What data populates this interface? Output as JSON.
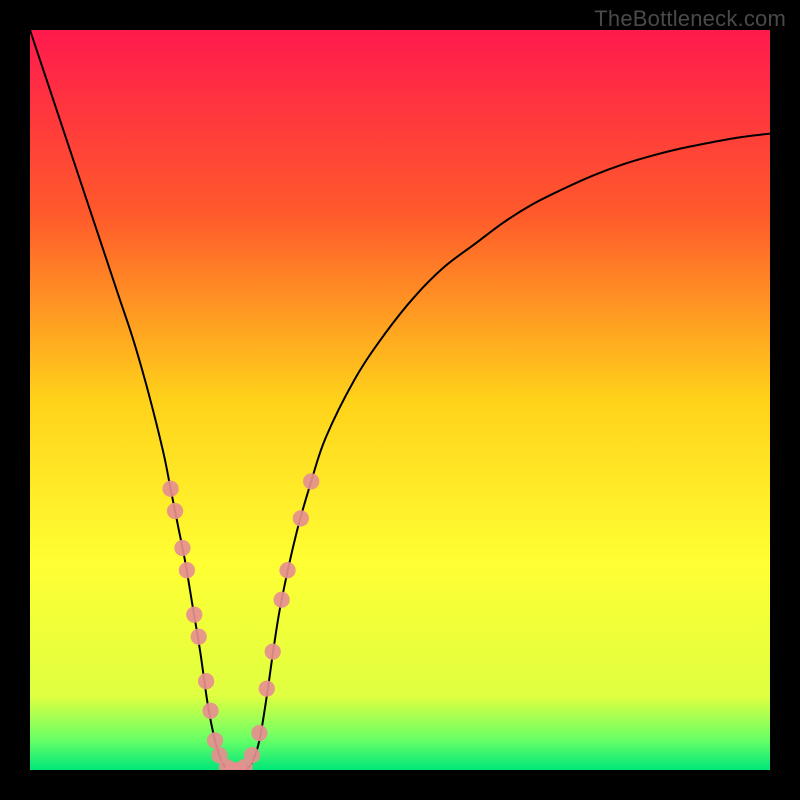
{
  "watermark": "TheBottleneck.com",
  "chart_data": {
    "type": "line",
    "title": "",
    "xlabel": "",
    "ylabel": "",
    "xlim": [
      0,
      100
    ],
    "ylim": [
      0,
      100
    ],
    "grid": false,
    "background_gradient": {
      "stops": [
        {
          "pos": 0.0,
          "color": "#ff1a4d"
        },
        {
          "pos": 0.25,
          "color": "#ff5a2b"
        },
        {
          "pos": 0.5,
          "color": "#ffd21a"
        },
        {
          "pos": 0.72,
          "color": "#ffff33"
        },
        {
          "pos": 0.9,
          "color": "#dfff40"
        },
        {
          "pos": 0.96,
          "color": "#66ff66"
        },
        {
          "pos": 1.0,
          "color": "#00e67a"
        }
      ]
    },
    "series": [
      {
        "name": "bottleneck-curve",
        "color": "#000000",
        "x": [
          0,
          2,
          4,
          6,
          8,
          10,
          12,
          14,
          16,
          18,
          19,
          20,
          21,
          22,
          23,
          24,
          25,
          26,
          27,
          28,
          29,
          30,
          31,
          32,
          33,
          34,
          36,
          38,
          40,
          44,
          48,
          52,
          56,
          60,
          64,
          68,
          72,
          76,
          80,
          84,
          88,
          92,
          96,
          100
        ],
        "y": [
          100,
          94,
          88,
          82,
          76,
          70,
          64,
          58,
          51,
          43,
          38,
          33,
          28,
          22,
          16,
          9,
          4,
          1,
          0,
          0,
          0,
          1,
          4,
          10,
          17,
          23,
          32,
          39,
          45,
          53,
          59,
          64,
          68,
          71,
          74,
          76.5,
          78.5,
          80.3,
          81.8,
          83,
          84,
          84.8,
          85.5,
          86
        ]
      }
    ],
    "highlight_points": {
      "name": "data-markers",
      "color": "#e68f8f",
      "radius_pct": 1.1,
      "points": [
        {
          "x": 19.0,
          "y": 38
        },
        {
          "x": 19.6,
          "y": 35
        },
        {
          "x": 20.6,
          "y": 30
        },
        {
          "x": 21.2,
          "y": 27
        },
        {
          "x": 22.2,
          "y": 21
        },
        {
          "x": 22.8,
          "y": 18
        },
        {
          "x": 23.8,
          "y": 12
        },
        {
          "x": 24.4,
          "y": 8
        },
        {
          "x": 25.0,
          "y": 4
        },
        {
          "x": 25.6,
          "y": 2
        },
        {
          "x": 26.6,
          "y": 0.4
        },
        {
          "x": 27.4,
          "y": 0
        },
        {
          "x": 28.2,
          "y": 0
        },
        {
          "x": 29.0,
          "y": 0.4
        },
        {
          "x": 30.0,
          "y": 2
        },
        {
          "x": 31.0,
          "y": 5
        },
        {
          "x": 32.0,
          "y": 11
        },
        {
          "x": 32.8,
          "y": 16
        },
        {
          "x": 34.0,
          "y": 23
        },
        {
          "x": 34.8,
          "y": 27
        },
        {
          "x": 36.6,
          "y": 34
        },
        {
          "x": 38.0,
          "y": 39
        }
      ]
    }
  }
}
